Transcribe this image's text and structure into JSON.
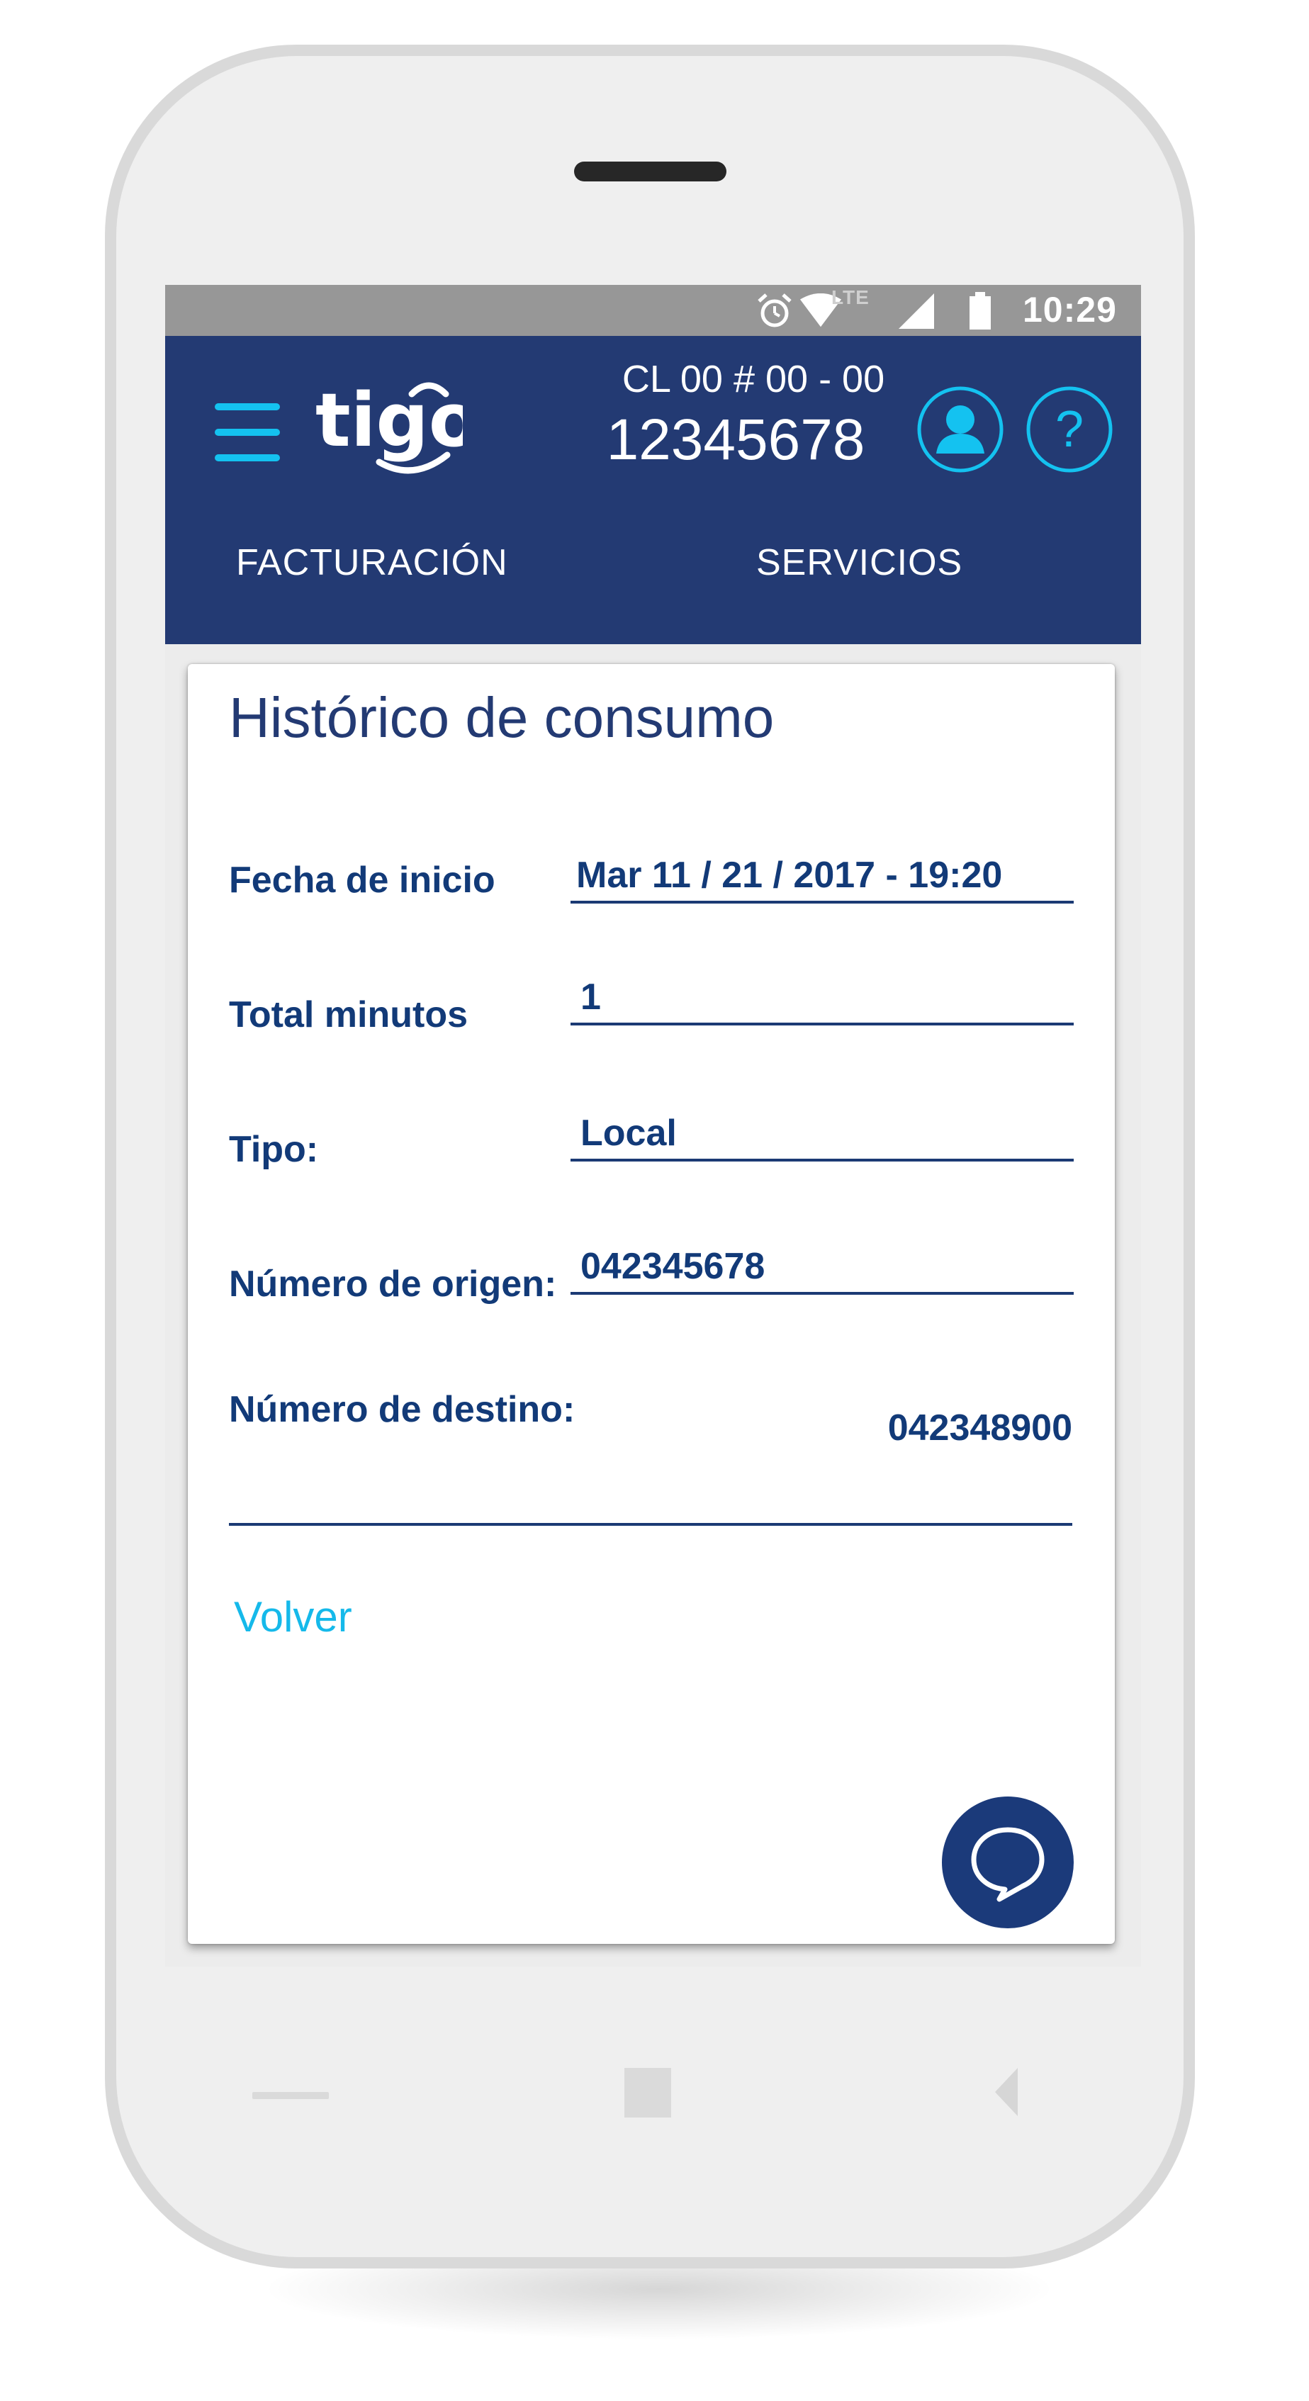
{
  "status_bar": {
    "network_label": "LTE",
    "time": "10:29",
    "icons": [
      "alarm-icon",
      "wifi-icon",
      "signal-icon",
      "battery-icon"
    ]
  },
  "header": {
    "brand": "tigo",
    "account_line": "CL 00 # 00 - 00",
    "phone_number": "12345678",
    "icons": [
      "menu-icon",
      "user-icon",
      "help-icon"
    ]
  },
  "tabs": [
    {
      "label": "FACTURACIÓN"
    },
    {
      "label": "SERVICIOS"
    }
  ],
  "card": {
    "title": "Histórico de consumo",
    "fields": {
      "start_date": {
        "label": "Fecha de inicio",
        "value": "Mar 11 / 21 / 2017 - 19:20"
      },
      "total_minutes": {
        "label": "Total minutos",
        "value": "1"
      },
      "type": {
        "label": "Tipo:",
        "value": "Local"
      },
      "origin": {
        "label": "Número de origen:",
        "value": "042345678"
      },
      "destination": {
        "label": "Número de destino:",
        "value": "042348900"
      }
    },
    "back_link": "Volver",
    "chat_icon": "chat-bubble-icon"
  },
  "colors": {
    "header_bg": "#233a73",
    "accent": "#14c2f0",
    "text_dark": "#123a78",
    "status_bar": "#979797"
  }
}
